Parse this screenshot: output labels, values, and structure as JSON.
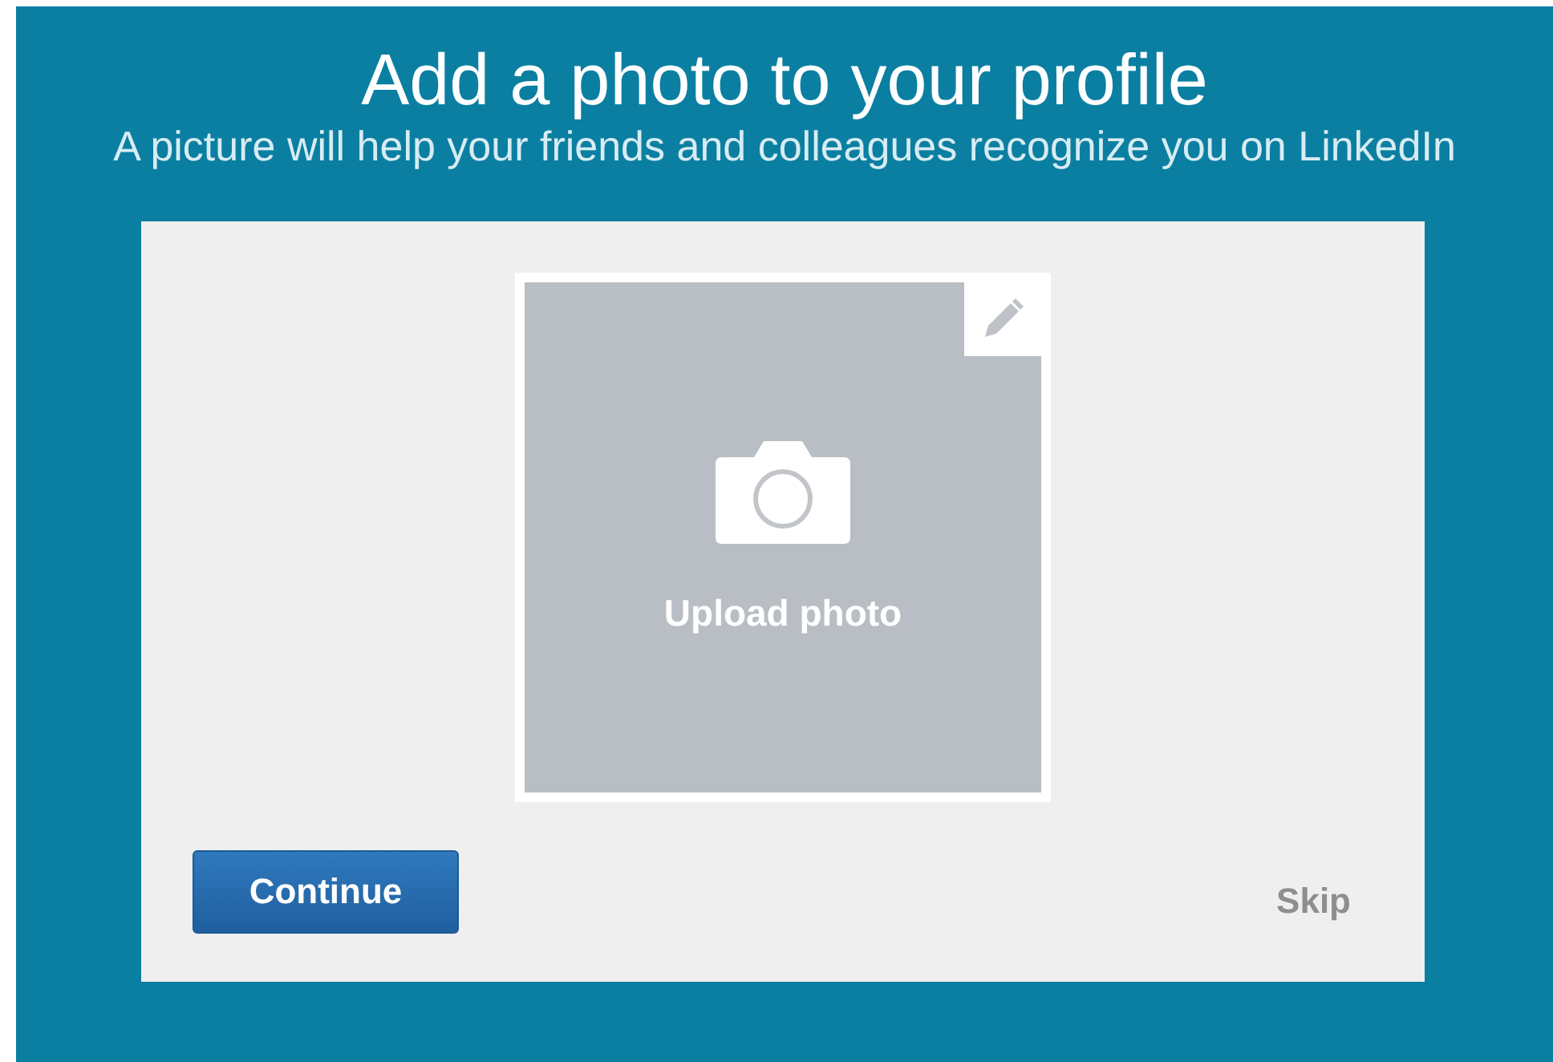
{
  "header": {
    "title": "Add a photo to your profile",
    "subtitle": "A picture will help your friends and colleagues recognize you on LinkedIn"
  },
  "photo": {
    "label": "Upload photo"
  },
  "actions": {
    "primary": "Continue",
    "secondary": "Skip"
  }
}
